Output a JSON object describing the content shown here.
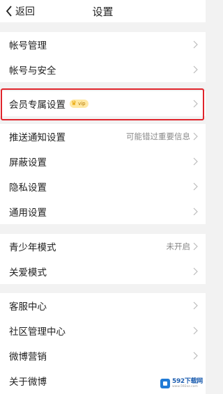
{
  "navbar": {
    "back_label": "返回",
    "title": "设置"
  },
  "groups": [
    {
      "items": [
        {
          "label": "帐号管理",
          "value": ""
        },
        {
          "label": "帐号与安全",
          "value": ""
        }
      ]
    },
    {
      "items": [
        {
          "label": "会员专属设置",
          "value": "",
          "badge": "vip"
        }
      ]
    },
    {
      "items": [
        {
          "label": "推送通知设置",
          "value": "可能错过重要信息"
        },
        {
          "label": "屏蔽设置",
          "value": ""
        },
        {
          "label": "隐私设置",
          "value": ""
        },
        {
          "label": "通用设置",
          "value": ""
        }
      ]
    },
    {
      "items": [
        {
          "label": "青少年模式",
          "value": "未开启"
        },
        {
          "label": "关爱模式",
          "value": ""
        }
      ]
    },
    {
      "items": [
        {
          "label": "客服中心",
          "value": ""
        },
        {
          "label": "社区管理中心",
          "value": ""
        },
        {
          "label": "微博营销",
          "value": ""
        },
        {
          "label": "关于微博",
          "value": ""
        }
      ]
    }
  ],
  "watermark": {
    "main": "592下载网",
    "sub": "www.592xz.com"
  },
  "colors": {
    "highlight_border": "#e0242b",
    "background": "#f2f2f2",
    "badge_bg": "#ffe8a3"
  }
}
